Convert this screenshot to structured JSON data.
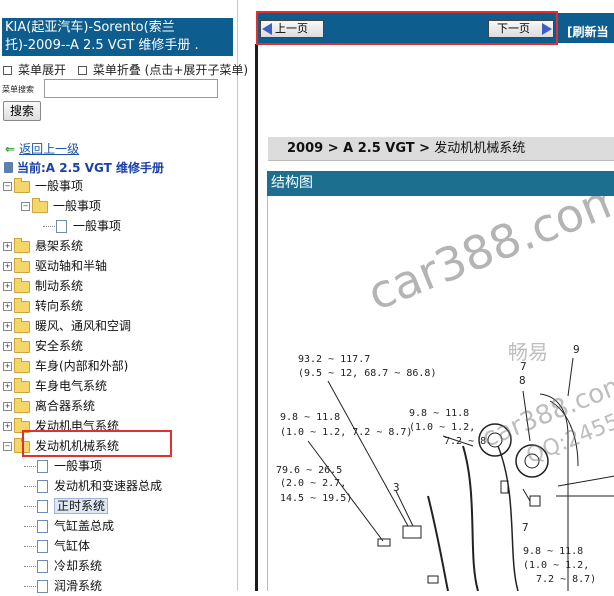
{
  "left_panel": {
    "title": "KIA(起亚汽车)-Sorento(索兰托)-2009--A 2.5 VGT 维修手册 .",
    "expand_all": "菜单展开",
    "collapse_all": "菜单折叠 (点击+展开子菜单)",
    "search_label": "菜单搜索",
    "search_value": "",
    "search_button": "搜索",
    "back_link": "返回上一级",
    "current_label": "当前:A 2.5 VGT 维修手册",
    "tree": [
      {
        "label": "一般事项"
      },
      {
        "label": "一般事项"
      },
      {
        "label": "一般事项"
      },
      {
        "label": "悬架系统"
      },
      {
        "label": "驱动轴和半轴"
      },
      {
        "label": "制动系统"
      },
      {
        "label": "转向系统"
      },
      {
        "label": "暖风、通风和空调"
      },
      {
        "label": "安全系统"
      },
      {
        "label": "车身(内部和外部)"
      },
      {
        "label": "车身电气系统"
      },
      {
        "label": "离合器系统"
      },
      {
        "label": "发动机电气系统"
      },
      {
        "label": "发动机机械系统"
      },
      {
        "label": "一般事项"
      },
      {
        "label": "发动机和变速器总成"
      },
      {
        "label": "正时系统"
      },
      {
        "label": "气缸盖总成"
      },
      {
        "label": "气缸体"
      },
      {
        "label": "冷却系统"
      },
      {
        "label": "润滑系统"
      }
    ]
  },
  "nav": {
    "prev": "上一页",
    "next": "下一页",
    "refresh": "[刷新当"
  },
  "content": {
    "breadcrumb_bold": "2009 > A 2.5 VGT >",
    "breadcrumb_rest": " 发动机机械系统",
    "section_title": "结构图",
    "annotations": {
      "a1": "93.2 ~ 117.7",
      "a2": "(9.5 ~ 12, 68.7 ~ 86.8)",
      "a3": "9.8 ~ 11.8",
      "a4": "(1.0 ~ 1.2, 7.2 ~ 8.7)",
      "a5": "9.8 ~ 11.8",
      "a6": "(1.0 ~ 1.2,",
      "a7": "7.2 ~ 8.",
      "a8": "79.6 ~ 26.5",
      "a9": "(2.0 ~ 2.7,",
      "a10": "14.5 ~ 19.5)",
      "a11": "9.8 ~ 11.8",
      "a12": "(1.0 ~ 1.2,",
      "a13": "7.2 ~ 8.7)",
      "n3": "3",
      "n7": "7",
      "n8": "8",
      "n9": "9"
    },
    "watermarks": {
      "w1": "car388.com",
      "w2": "畅易",
      "w3": "car388.com",
      "w4": "QQ:2455"
    }
  },
  "colors": {
    "title_bg": "#0d5d8f",
    "section_bg": "#1d6f8f",
    "highlight": "#e03030"
  }
}
